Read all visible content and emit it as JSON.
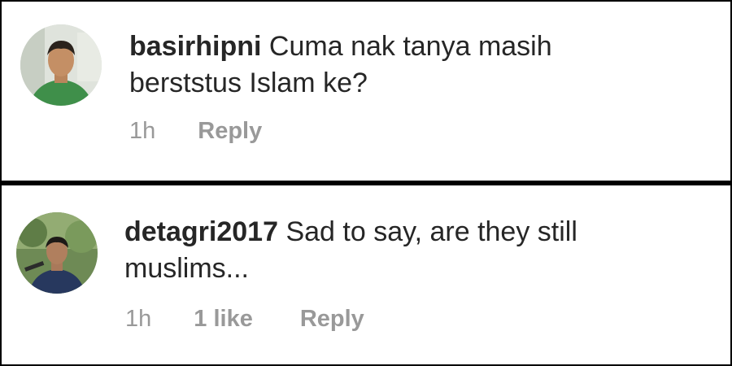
{
  "comments": [
    {
      "username": "basirhipni",
      "text_line1": "Cuma nak tanya masih",
      "text_line2": "berststus Islam ke?",
      "time": "1h",
      "likes": "",
      "reply_label": "Reply"
    },
    {
      "username": "detagri2017",
      "text_line1": "Sad to say, are they still",
      "text_line2": "muslims...",
      "time": "1h",
      "likes": "1 like",
      "reply_label": "Reply"
    }
  ],
  "colors": {
    "text": "#262626",
    "meta": "#999999",
    "divider": "#000000",
    "background": "#ffffff"
  }
}
